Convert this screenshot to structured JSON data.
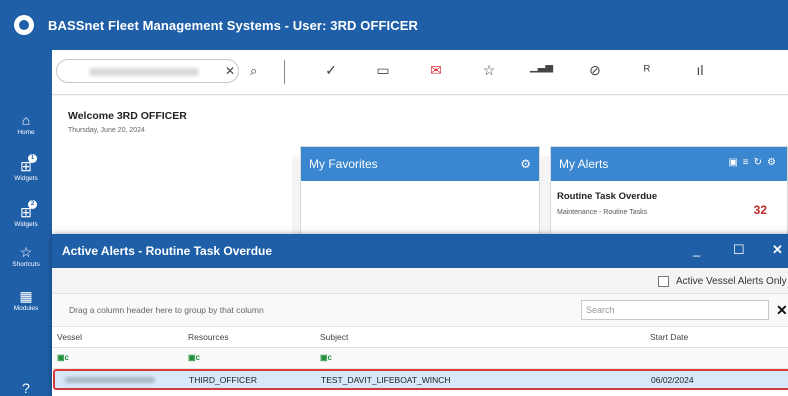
{
  "app": {
    "title": "BASSnet Fleet Management Systems - User: 3RD OFFICER",
    "accent": "#1f5fa8",
    "panel_accent": "#3a86cf",
    "alert_color": "#c0282a"
  },
  "sidebar": {
    "items": [
      {
        "label": "Home",
        "icon": "home-icon",
        "glyph": "⌂"
      },
      {
        "label": "Widgets",
        "icon": "widgets-icon",
        "glyph": "⊞",
        "badge": "1"
      },
      {
        "label": "Widgets",
        "icon": "widgets-icon",
        "glyph": "⊞",
        "badge": "2"
      },
      {
        "label": "Shortcuts",
        "icon": "star-icon",
        "glyph": "☆"
      },
      {
        "label": "Modules",
        "icon": "modules-icon",
        "glyph": "▦"
      },
      {
        "label": "",
        "icon": "help-icon",
        "glyph": "?"
      }
    ]
  },
  "toolbar": {
    "search_clear": "✕",
    "search_icon": "⌕",
    "buttons": [
      {
        "icon": "check-icon",
        "glyph": "✓"
      },
      {
        "icon": "chat-icon",
        "glyph": "▭"
      },
      {
        "icon": "mail-alert-icon",
        "glyph": "✉"
      },
      {
        "icon": "star-list-icon",
        "glyph": "☆"
      },
      {
        "icon": "chart-icon",
        "glyph": "▁▃▅"
      },
      {
        "icon": "check-circle-icon",
        "glyph": "⊘"
      },
      {
        "icon": "user-search-icon",
        "glyph": "ᴿ"
      },
      {
        "icon": "bar-chart-icon",
        "glyph": "ıl"
      }
    ]
  },
  "dashboard": {
    "welcome": "Welcome 3RD OFFICER",
    "date": "Thursday, June 20, 2024",
    "favorites": {
      "title": "My Favorites"
    },
    "alerts": {
      "title": "My Alerts",
      "item_title": "Routine Task Overdue",
      "item_sub": "Maintenance - Routine Tasks",
      "item_count": "32"
    }
  },
  "modal": {
    "title": "Active Alerts - Routine Task Overdue",
    "minimize": "_",
    "maximize": "☐",
    "close": "✕",
    "checkbox_label": "Active Vessel Alerts Only",
    "group_hint": "Drag a column header here to group by that column",
    "search_placeholder": "Search",
    "search_clear": "✕",
    "columns": [
      "Vessel",
      "Resources",
      "Subject",
      "Start Date"
    ],
    "filter_glyph": "▣c",
    "row": {
      "resources": "THIRD_OFFICER",
      "subject": "TEST_DAVIT_LIFEBOAT_WINCH",
      "start_date": "06/02/2024"
    }
  }
}
